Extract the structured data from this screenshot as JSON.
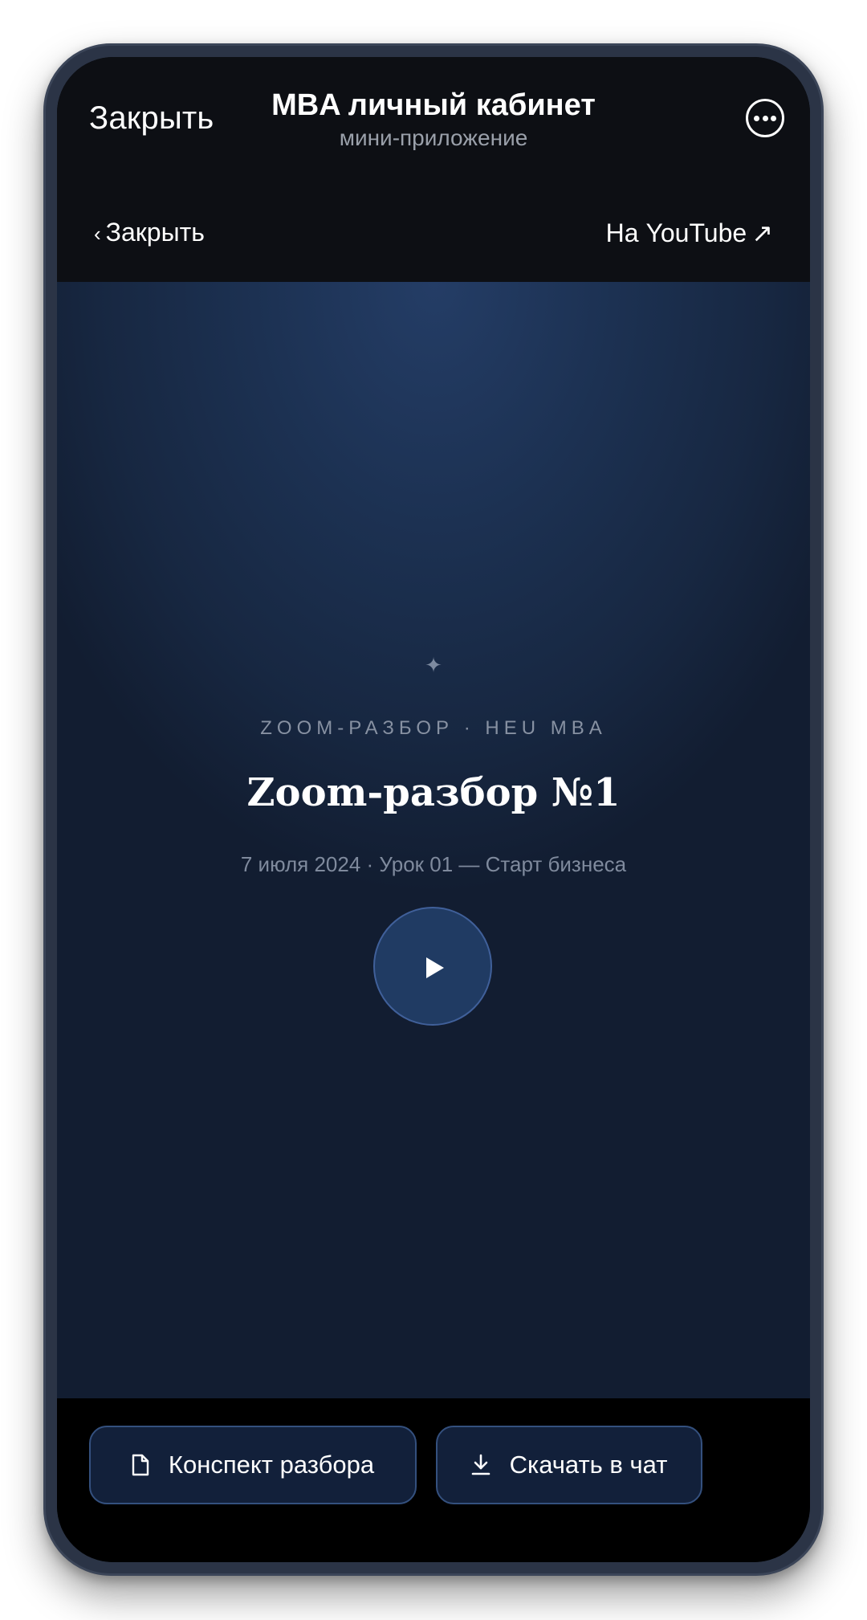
{
  "tg_header": {
    "close_label": "Закрыть",
    "title": "MBA личный кабинет",
    "subtitle": "мини-приложение",
    "more_icon": "more-circle-icon"
  },
  "video_nav": {
    "back_chevron": "‹",
    "back_label": "Закрыть",
    "youtube_label": "На YouTube",
    "youtube_arrow": "↗"
  },
  "video": {
    "sparkle": "✦",
    "kicker": "ZOOM-РАЗБОР · HEU MBA",
    "title": "Zoom-разбор №1",
    "meta": "7 июля 2024 · Урок 01 — Старт бизнеса",
    "play_icon": "play-icon"
  },
  "actions": {
    "notes_label": "Конспект разбора",
    "notes_icon": "document-icon",
    "download_label": "Скачать в чат",
    "download_icon": "download-icon"
  },
  "colors": {
    "header_bg": "#0d0f14",
    "video_bg": "#1c3152",
    "accent_border": "#34507e",
    "button_bg": "#12203a"
  }
}
